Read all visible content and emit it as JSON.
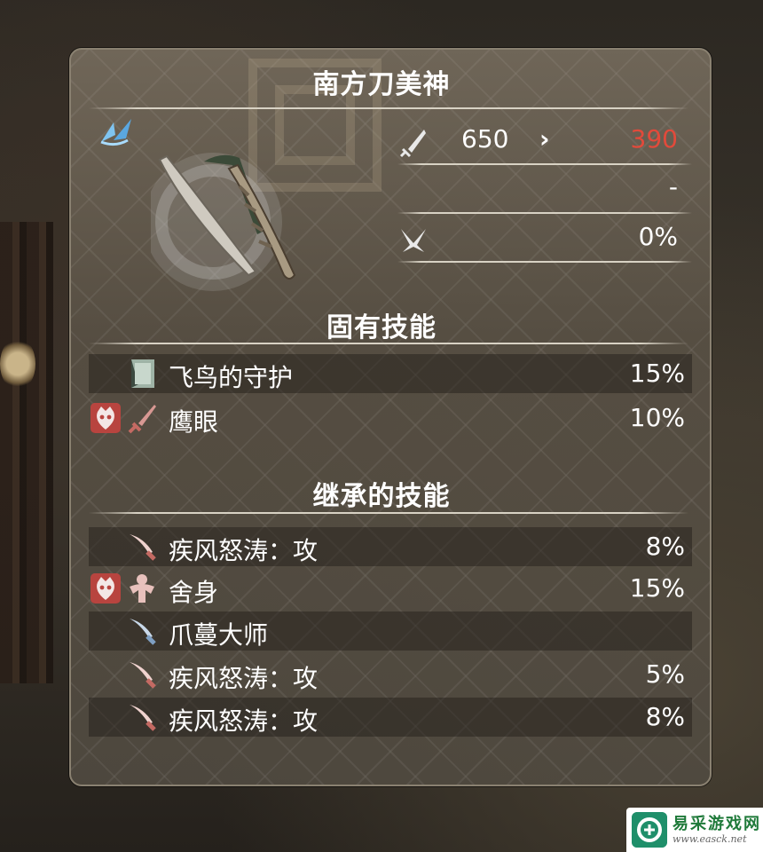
{
  "weapon": {
    "name": "南方刀美神",
    "type_icon": "blade-wing-icon",
    "colors": {
      "accent_red": "#e24a3b",
      "text": "#ffffff",
      "badge_red": "#b8443f",
      "type_blue": "#6fb6e8"
    }
  },
  "stats": [
    {
      "icon": "attack-sword-icon",
      "before": "650",
      "arrow": "›",
      "after": "390"
    },
    {
      "icon": "",
      "before": "",
      "arrow": "",
      "after": "-"
    },
    {
      "icon": "critical-icon",
      "before": "",
      "arrow": "",
      "after": "0%"
    }
  ],
  "inherent": {
    "heading": "固有技能",
    "skills": [
      {
        "name": "飞鸟的守护",
        "pct": "15%",
        "icon": "guard-banner-icon",
        "badge": false
      },
      {
        "name": "鹰眼",
        "pct": "10%",
        "icon": "sword-icon",
        "badge": true,
        "badge_icon": "oni-mask-icon"
      }
    ]
  },
  "inherited": {
    "heading": "继承的技能",
    "skills": [
      {
        "name": "疾风怒涛：攻",
        "pct": "8%",
        "icon": "curved-blade-icon",
        "badge": false
      },
      {
        "name": "舍身",
        "pct": "15%",
        "icon": "muscle-torso-icon",
        "badge": true,
        "badge_icon": "oni-mask-icon"
      },
      {
        "name": "爪蔓大师",
        "pct": "",
        "icon": "claw-blade-icon",
        "badge": false
      },
      {
        "name": "疾风怒涛：攻",
        "pct": "5%",
        "icon": "curved-blade-icon",
        "badge": false
      },
      {
        "name": "疾风怒涛：攻",
        "pct": "8%",
        "icon": "curved-blade-icon",
        "badge": false
      }
    ]
  },
  "watermark": {
    "text": "易采游戏网",
    "url": "www.easck.net"
  }
}
